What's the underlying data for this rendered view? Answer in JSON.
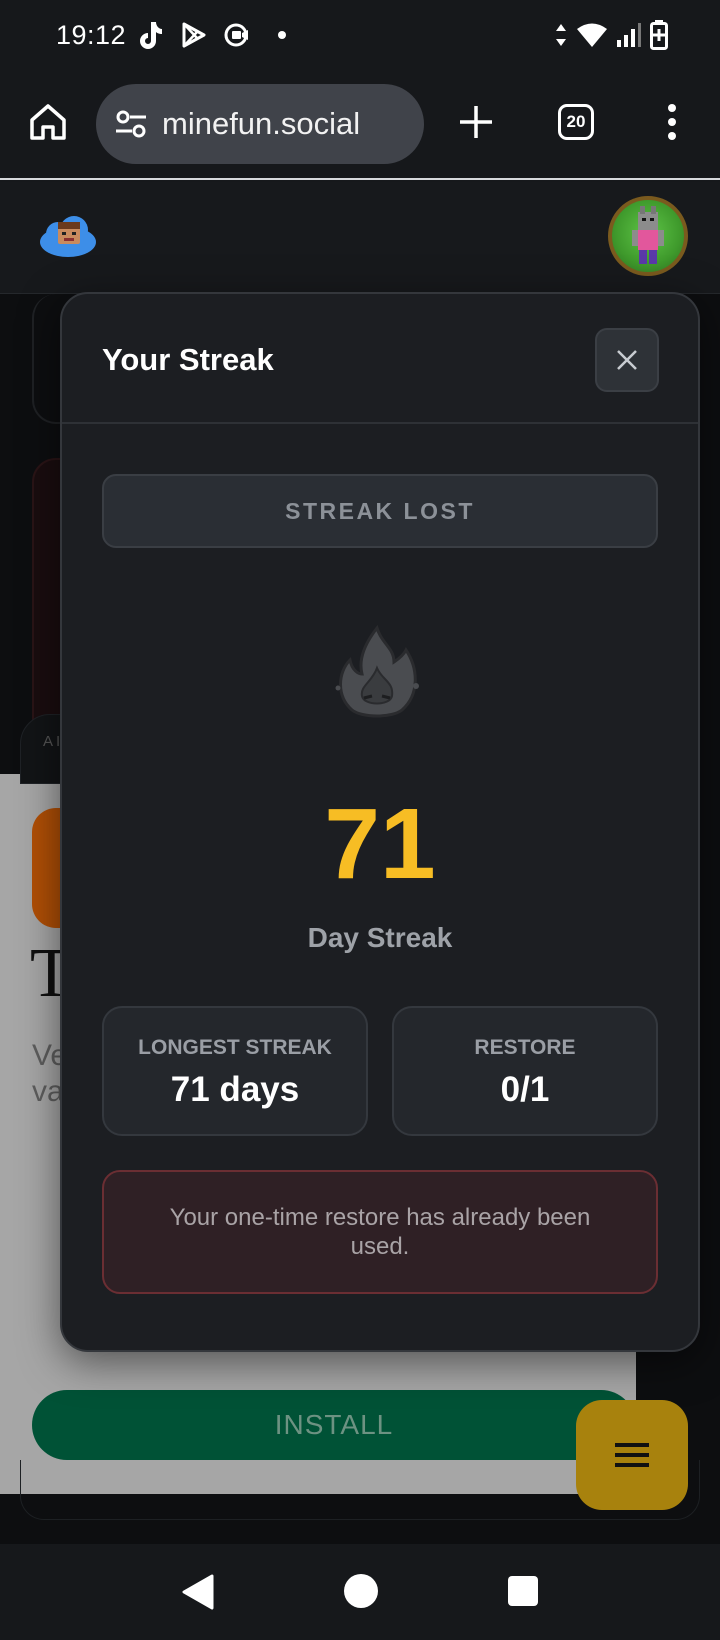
{
  "status_bar": {
    "time": "19:12",
    "left_icons": [
      "tiktok-icon",
      "play-store-icon",
      "screen-record-icon",
      "notification-dot"
    ],
    "right_icons": [
      "data-arrows-icon",
      "wifi-icon",
      "signal-icon",
      "battery-charging-icon"
    ]
  },
  "browser": {
    "url": "minefun.social",
    "tab_count": "20",
    "buttons": [
      "home-icon",
      "site-settings-icon",
      "new-tab-icon",
      "tab-switcher",
      "more-menu-icon"
    ]
  },
  "background_page": {
    "badge_text": "AI",
    "big_letter": "T",
    "ghost_text": "Ve ex va",
    "install_label": "INSTALL"
  },
  "modal": {
    "title": "Your Streak",
    "status": "STREAK LOST",
    "streak_count": "71",
    "streak_label": "Day Streak",
    "stats": [
      {
        "label": "LONGEST STREAK",
        "value": "71 days"
      },
      {
        "label": "RESTORE",
        "value": "0/1"
      }
    ],
    "notice": "Your one-time restore has already been used."
  },
  "colors": {
    "accent_yellow": "#f7bd24",
    "notice_border": "#6b2e33",
    "install_green": "#005236",
    "fab": "#a8820d"
  }
}
